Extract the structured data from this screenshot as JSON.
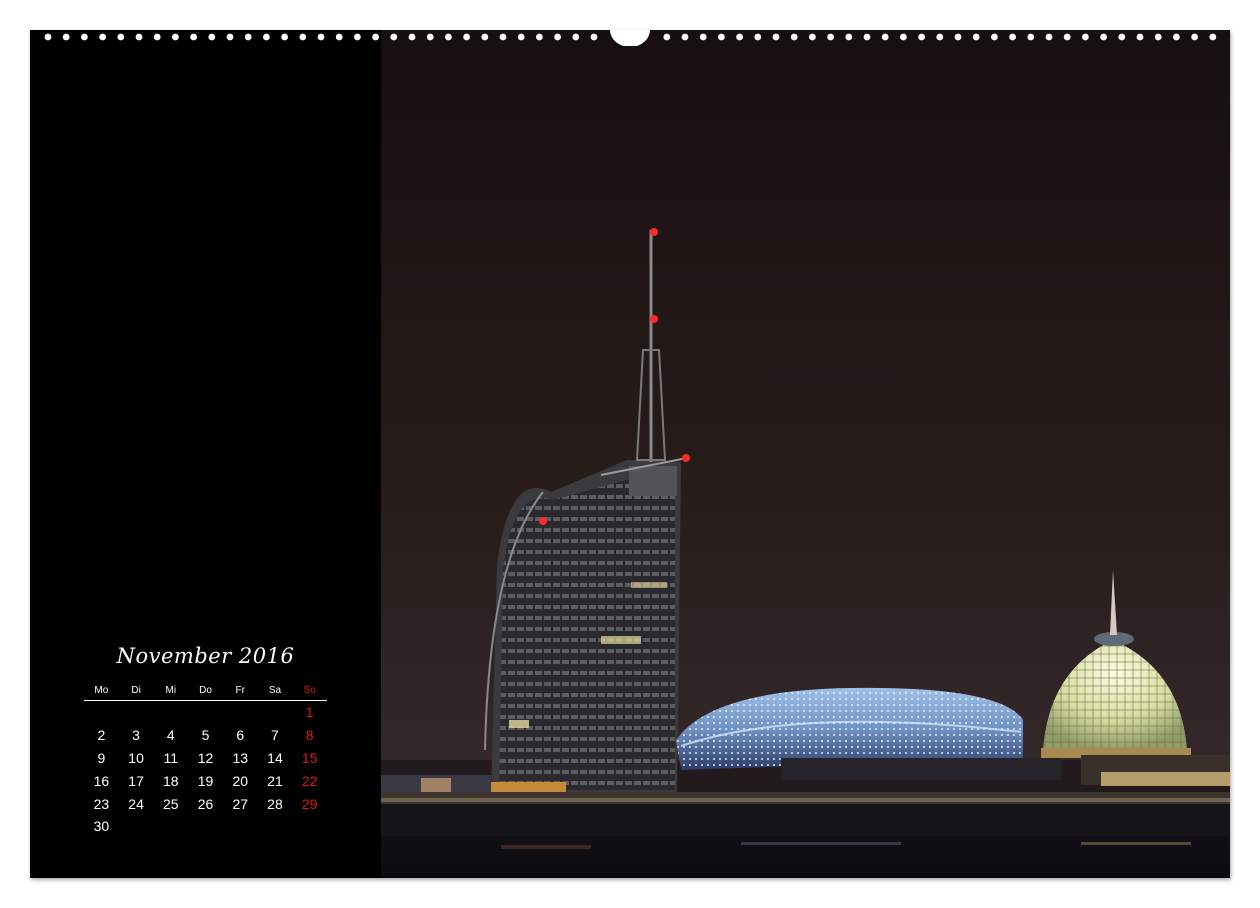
{
  "calendar": {
    "title": "November 2016",
    "weekdays": [
      "Mo",
      "Di",
      "Mi",
      "Do",
      "Fr",
      "Sa",
      "So"
    ],
    "weeks": [
      [
        "",
        "",
        "",
        "",
        "",
        "",
        "1"
      ],
      [
        "2",
        "3",
        "4",
        "5",
        "6",
        "7",
        "8"
      ],
      [
        "9",
        "10",
        "11",
        "12",
        "13",
        "14",
        "15"
      ],
      [
        "16",
        "17",
        "18",
        "19",
        "20",
        "21",
        "22"
      ],
      [
        "23",
        "24",
        "25",
        "26",
        "27",
        "28",
        "29"
      ],
      [
        "30",
        "",
        "",
        "",
        "",
        "",
        ""
      ]
    ]
  },
  "colors": {
    "background": "#000000",
    "sunday": "#e01818",
    "text": "#ffffff"
  }
}
